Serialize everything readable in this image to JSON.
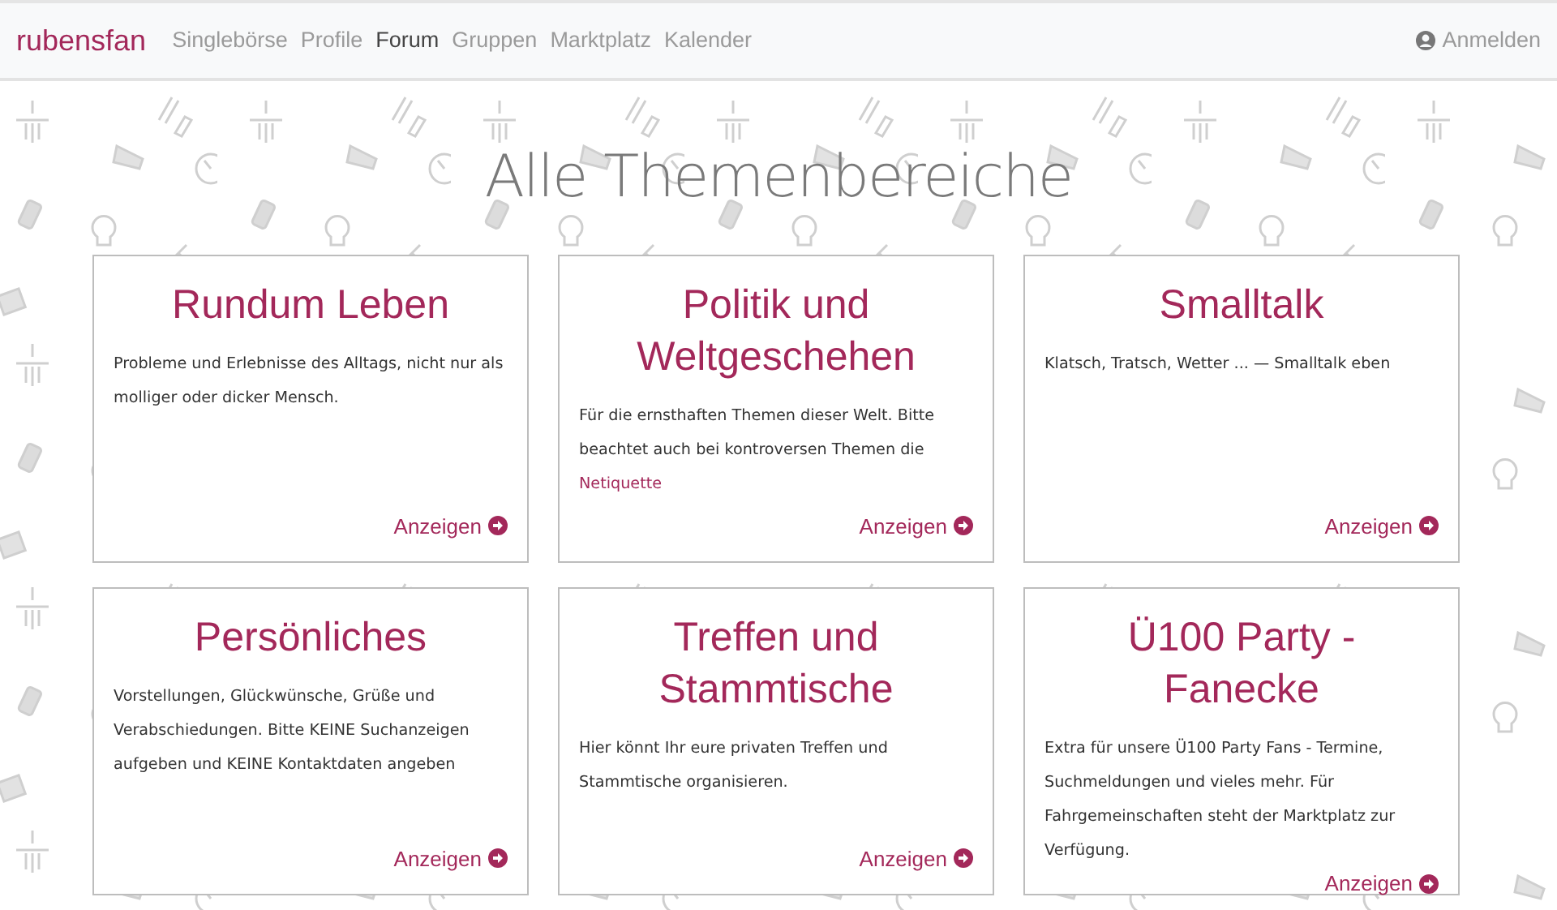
{
  "navbar": {
    "brand": "rubensfan",
    "items": [
      {
        "label": "Singlebörse",
        "selected": false
      },
      {
        "label": "Profile",
        "selected": false
      },
      {
        "label": "Forum",
        "selected": true
      },
      {
        "label": "Gruppen",
        "selected": false
      },
      {
        "label": "Marktplatz",
        "selected": false
      },
      {
        "label": "Kalender",
        "selected": false
      }
    ],
    "login": "Anmelden"
  },
  "heading": "Alle Themenbereiche",
  "forums": [
    {
      "title": "Rundum Leben",
      "description": "Probleme und Erlebnisse des Alltags, nicht nur als molliger oder dicker Mensch.",
      "action": "Anzeigen"
    },
    {
      "title": "Politik und Weltgeschehen",
      "description": "Für die ernsthaften Themen dieser Welt. Bitte beachtet auch bei kontroversen Themen die",
      "link": "Netiquette",
      "action": "Anzeigen"
    },
    {
      "title": "Smalltalk",
      "description": "Klatsch, Tratsch, Wetter ... — Smalltalk eben",
      "action": "Anzeigen"
    },
    {
      "title": "Persönliches",
      "description": "Vorstellungen, Glückwünsche, Grüße und Verabschiedungen. Bitte KEINE Suchanzeigen aufgeben und KEINE Kontaktdaten angeben",
      "action": "Anzeigen"
    },
    {
      "title": "Treffen und Stammtische",
      "description": "Hier könnt Ihr eure privaten Treffen und Stammtische organisieren.",
      "action": "Anzeigen"
    },
    {
      "title": "Ü100 Party - Fanecke",
      "description": "Extra für unsere Ü100 Party Fans - Termine, Suchmeldungen und vieles mehr. Für Fahrgemeinschaften steht der Marktplatz zur Verfügung.",
      "action": "Anzeigen"
    }
  ]
}
